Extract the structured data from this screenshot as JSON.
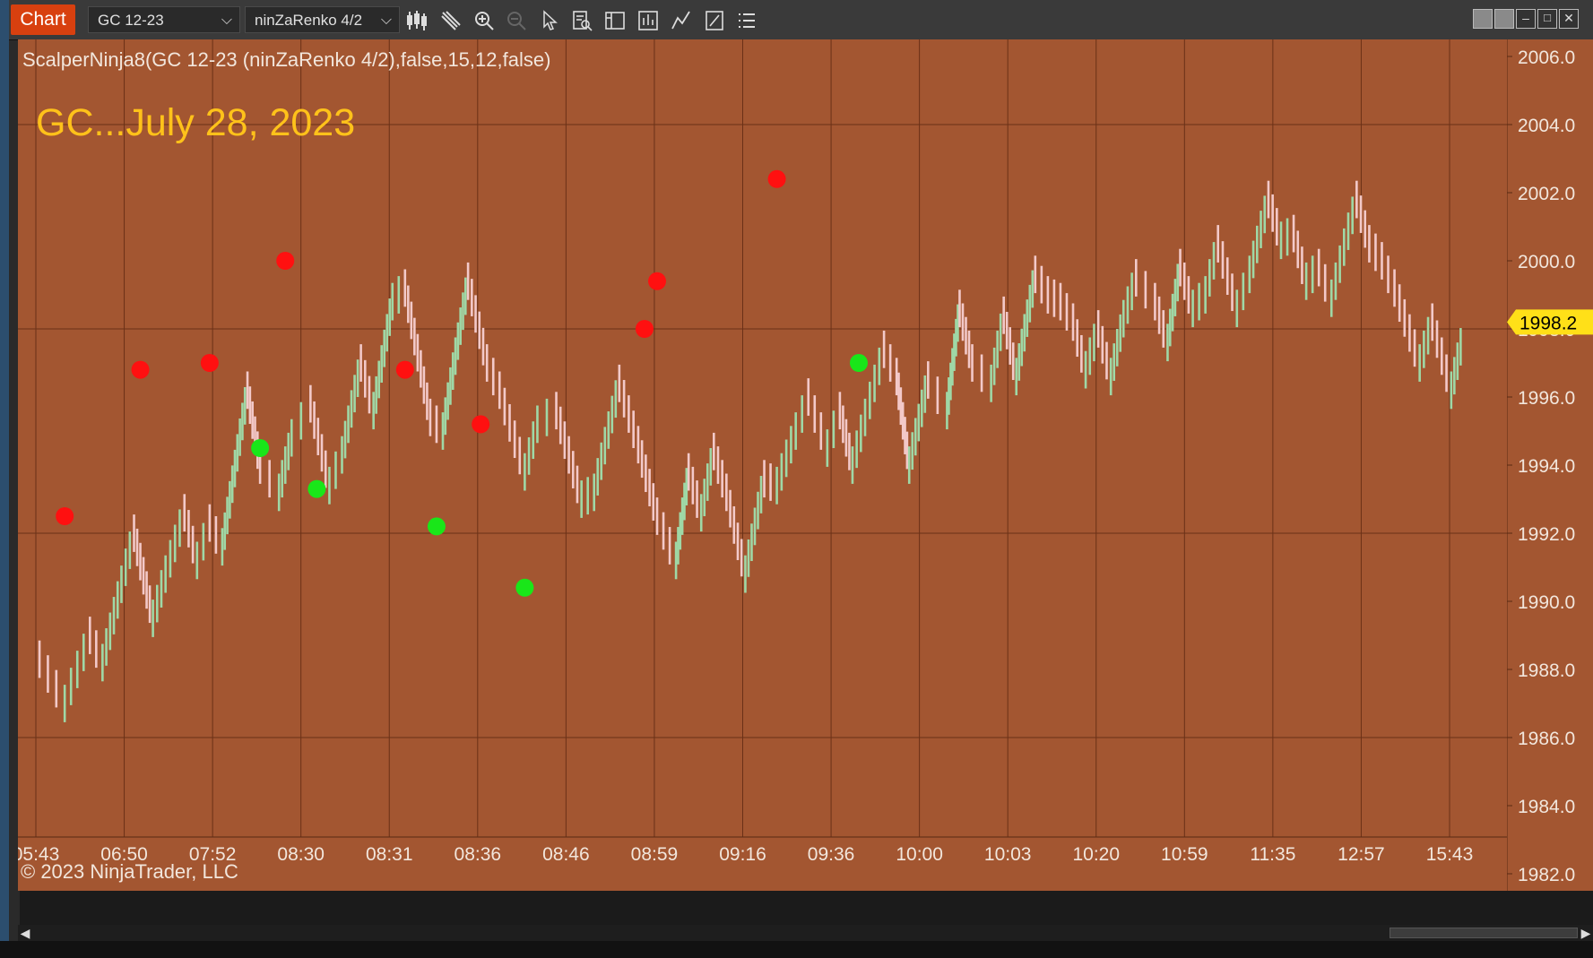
{
  "window": {
    "tab_label": "Chart",
    "instrument": "GC 12-23",
    "bar_type": "ninZaRenko 4/2",
    "toolbar_icons": [
      "bar-style-icon",
      "draw-pencil-icon",
      "zoom-in-icon",
      "zoom-out-icon",
      "pointer-icon",
      "data-box-icon",
      "chart-trader-icon",
      "indicators-icon",
      "strategies-icon",
      "properties-icon",
      "list-icon"
    ],
    "window_buttons": [
      "layout-icon",
      "layout-alt-icon",
      "minimize-icon",
      "maximize-icon",
      "close-icon"
    ]
  },
  "overlay": {
    "indicator_label": "ScalperNinja8(GC 12-23 (ninZaRenko 4/2),false,15,12,false)",
    "annotation": "GC...July 28, 2023",
    "copyright": "© 2023 NinjaTrader, LLC"
  },
  "colors": {
    "background": "#a35631",
    "grid": "#6a3017",
    "candle_up": "#9fd8a6",
    "candle_down": "#f3c9c9",
    "sell_dot": "#ff1010",
    "buy_dot": "#19e619",
    "price_tag": "#ffe018"
  },
  "chart_data": {
    "type": "line",
    "title": "",
    "xlabel": "",
    "ylabel": "",
    "ylim": [
      1981.5,
      2006.5
    ],
    "y_ticks": [
      "2006.0",
      "2004.0",
      "2002.0",
      "2000.0",
      "1998.0",
      "1996.0",
      "1994.0",
      "1992.0",
      "1990.0",
      "1988.0",
      "1986.0",
      "1984.0",
      "1982.0"
    ],
    "x_ticks": [
      "05:43",
      "06:50",
      "07:52",
      "08:30",
      "08:31",
      "08:36",
      "08:46",
      "08:59",
      "09:16",
      "09:36",
      "10:00",
      "10:03",
      "10:20",
      "10:59",
      "11:35",
      "12:57",
      "15:43"
    ],
    "last_price": "1998.2",
    "grid": true,
    "series": [
      {
        "values": [
          [
            0,
            1988.3
          ],
          [
            4,
            1987.0
          ],
          [
            8,
            1989.0
          ],
          [
            10,
            1988.2
          ],
          [
            13,
            1990.5
          ],
          [
            15,
            1992.0
          ],
          [
            18,
            1989.5
          ],
          [
            20,
            1990.8
          ],
          [
            23,
            1992.6
          ],
          [
            25,
            1991.2
          ],
          [
            27,
            1992.3
          ],
          [
            29,
            1991.6
          ],
          [
            33,
            1996.2
          ],
          [
            35,
            1994.0
          ],
          [
            38,
            1993.2
          ],
          [
            40,
            1994.8
          ],
          [
            43,
            1995.8
          ],
          [
            46,
            1993.4
          ],
          [
            48,
            1994.3
          ],
          [
            51,
            1997.0
          ],
          [
            53,
            1995.6
          ],
          [
            56,
            1998.8
          ],
          [
            58,
            1999.2
          ],
          [
            62,
            1995.4
          ],
          [
            64,
            1995.0
          ],
          [
            68,
            1999.4
          ],
          [
            71,
            1997.0
          ],
          [
            73,
            1996.2
          ],
          [
            77,
            1993.8
          ],
          [
            79,
            1995.2
          ],
          [
            82,
            1995.6
          ],
          [
            86,
            1993.0
          ],
          [
            88,
            1993.2
          ],
          [
            92,
            1996.4
          ],
          [
            95,
            1994.6
          ],
          [
            98,
            1992.5
          ],
          [
            101,
            1991.2
          ],
          [
            103,
            1993.8
          ],
          [
            105,
            1992.6
          ],
          [
            107,
            1994.4
          ],
          [
            109,
            1993.2
          ],
          [
            112,
            1990.8
          ],
          [
            115,
            1993.6
          ],
          [
            117,
            1993.4
          ],
          [
            120,
            1995.0
          ],
          [
            122,
            1996.0
          ],
          [
            125,
            1994.5
          ],
          [
            127,
            1995.6
          ],
          [
            129,
            1994.0
          ],
          [
            131,
            1995.4
          ],
          [
            134,
            1997.4
          ],
          [
            136,
            1996.6
          ],
          [
            138,
            1994.0
          ],
          [
            141,
            1996.5
          ],
          [
            144,
            1995.6
          ],
          [
            146,
            1998.6
          ],
          [
            148,
            1997.0
          ],
          [
            151,
            1996.4
          ],
          [
            153,
            1998.4
          ],
          [
            155,
            1996.6
          ],
          [
            158,
            1999.6
          ],
          [
            160,
            1999.0
          ],
          [
            162,
            1998.8
          ],
          [
            164,
            1998.2
          ],
          [
            166,
            1996.8
          ],
          [
            168,
            1998.0
          ],
          [
            170,
            1996.6
          ],
          [
            172,
            1998.3
          ],
          [
            174,
            1999.5
          ],
          [
            177,
            1998.8
          ],
          [
            179,
            1997.6
          ],
          [
            181,
            1999.8
          ],
          [
            183,
            1998.6
          ],
          [
            185,
            1999.0
          ],
          [
            187,
            2000.5
          ],
          [
            190,
            1998.6
          ],
          [
            192,
            1999.6
          ],
          [
            195,
            2001.8
          ],
          [
            197,
            2000.6
          ],
          [
            199,
            2000.8
          ],
          [
            201,
            1999.4
          ],
          [
            203,
            1999.8
          ],
          [
            205,
            1998.9
          ],
          [
            207,
            2000.4
          ],
          [
            209,
            2001.8
          ],
          [
            211,
            2000.5
          ],
          [
            213,
            2000.0
          ],
          [
            215,
            1999.2
          ],
          [
            219,
            1997.0
          ],
          [
            221,
            1998.2
          ],
          [
            224,
            1996.2
          ],
          [
            226,
            1997.9
          ]
        ]
      }
    ],
    "sell_signals": [
      [
        4,
        1992.5
      ],
      [
        16,
        1996.8
      ],
      [
        27,
        1997.0
      ],
      [
        39,
        2000.0
      ],
      [
        58,
        1996.8
      ],
      [
        70,
        1995.2
      ],
      [
        96,
        1998.0
      ],
      [
        98,
        1999.4
      ],
      [
        117,
        2002.4
      ]
    ],
    "buy_signals": [
      [
        35,
        1994.5
      ],
      [
        44,
        1993.3
      ],
      [
        63,
        1992.2
      ],
      [
        77,
        1990.4
      ],
      [
        130,
        1997.0
      ]
    ]
  }
}
